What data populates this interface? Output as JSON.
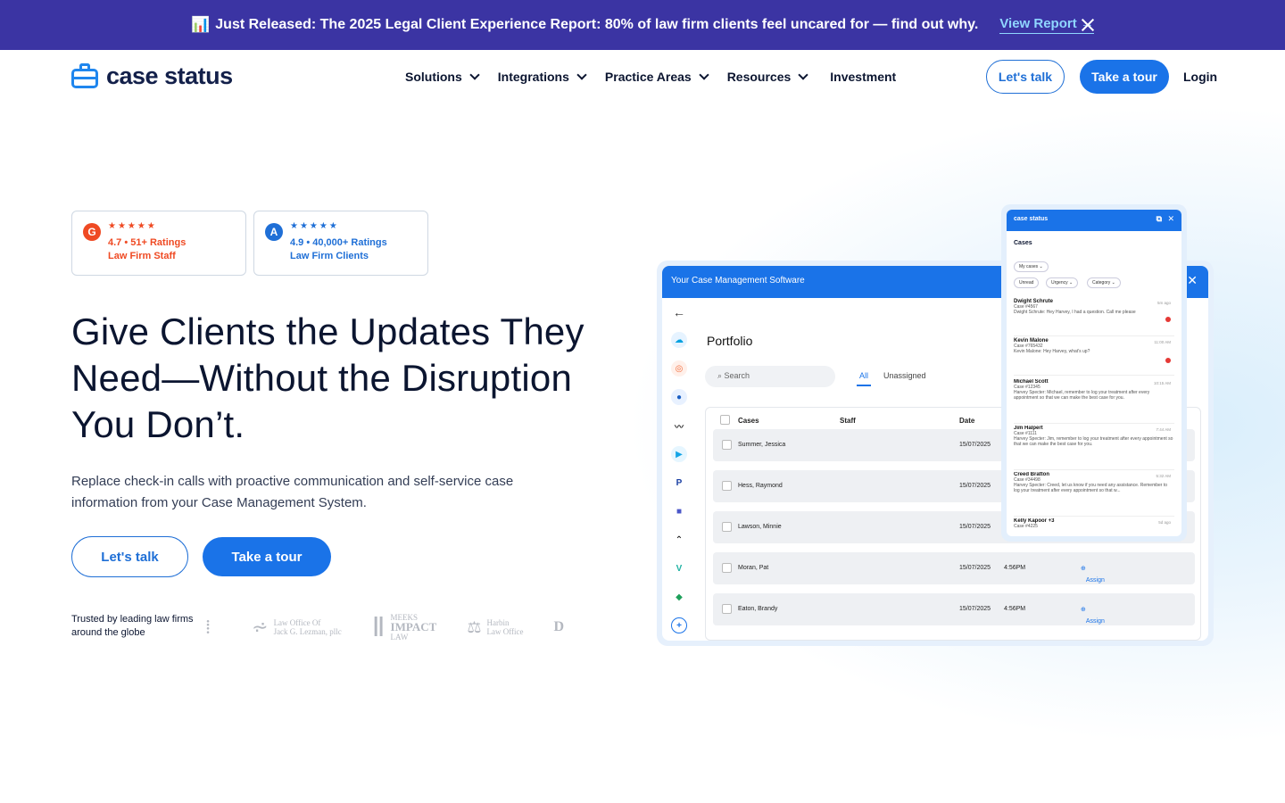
{
  "banner": {
    "emoji": "📊",
    "text": "Just Released: The 2025 Legal Client Experience Report: 80% of law firm clients feel uncared for — find out why.",
    "link": "View Report →"
  },
  "nav": {
    "logo_text": "case status",
    "menu": [
      {
        "label": "Solutions"
      },
      {
        "label": "Integrations"
      },
      {
        "label": "Practice Areas"
      },
      {
        "label": "Resources"
      }
    ],
    "investment": "Investment",
    "lets_talk": "Let's talk",
    "take_tour": "Take a tour",
    "login": "Login"
  },
  "ratings": [
    {
      "icon": "G",
      "stars": "★★★★★",
      "line1": "4.7 • 51+ Ratings",
      "line2": "Law Firm Staff",
      "color": "#ef4a23"
    },
    {
      "icon": "A",
      "stars": "★★★★★",
      "line1": "4.9 • 40,000+ Ratings",
      "line2": "Law Firm Clients",
      "color": "#1f6fd6"
    }
  ],
  "hero": {
    "headline": "Give Clients the Updates They Need—Without the Disruption You Don’t.",
    "sub": "Replace check-in calls with proactive communication and self-service case information from your Case Management System.",
    "cta_talk": "Let's talk",
    "cta_tour": "Take a tour",
    "trusted": "Trusted by leading law firms around the globe"
  },
  "logos": [
    {
      "line1": "Law Office Of",
      "line2": "Jack G. Lezman, pllc"
    },
    {
      "line1": "MEEKS",
      "line2": "IMPACT",
      "line3": "LAW"
    },
    {
      "line1": "Harbin",
      "line2": "Law Office"
    }
  ],
  "app": {
    "bar_title": "Your Case Management Software",
    "page_title": "Portfolio",
    "search_placeholder": "Search",
    "tab_all": "All",
    "tab_unassigned": "Unassigned",
    "col_cases": "Cases",
    "col_staff": "Staff",
    "col_date": "Date",
    "rows": [
      {
        "name": "Summer, Jessica",
        "date": "15/07/2025",
        "time": "4:",
        "assign": ""
      },
      {
        "name": "Hess, Raymond",
        "date": "15/07/2025",
        "time": "4:",
        "assign": ""
      },
      {
        "name": "Lawson, Minnie",
        "date": "15/07/2025",
        "time": "4:",
        "assign": ""
      },
      {
        "name": "Moran, Pat",
        "date": "15/07/2025",
        "time": "4:56PM",
        "assign": "Assign"
      },
      {
        "name": "Eaton, Brandy",
        "date": "15/07/2025",
        "time": "4:56PM",
        "assign": "Assign"
      }
    ]
  },
  "panel": {
    "title": "case status",
    "heading": "Cases",
    "filter_my": "My cases",
    "chips": [
      "Unread",
      "Urgency",
      "Category"
    ],
    "messages": [
      {
        "name": "Dwight Schrute",
        "case": "Case #4567",
        "msg": "Dwight Schrute: Hey Harvey, I had a question. Call me please",
        "time": "5m ago"
      },
      {
        "name": "Kevin Malone",
        "case": "Case #765432",
        "msg": "Kevin Malone: Hey Harvey, what's up?",
        "time": "11:00 AM"
      },
      {
        "name": "Michael Scott",
        "case": "Case #12345",
        "msg": "Harvey Specter: Michael, remember to log your treatment after every appointment so that we can make the best case for you.",
        "time": "10:15 AM"
      },
      {
        "name": "Jim Halpert",
        "case": "Case #1111",
        "msg": "Harvey Specter: Jim, remember to log your treatment after every appointment so that we can make the best case for you.",
        "time": "7:44 AM"
      },
      {
        "name": "Creed Bratton",
        "case": "Case #34498",
        "msg": "Harvey Specter: Creed, let us know if you need any assistance. Remember to log your treatment after every appointment so that w...",
        "time": "5:32 AM"
      },
      {
        "name": "Kelly Kapoor +3",
        "case": "Case #4225",
        "msg": "",
        "time": "5d ago"
      }
    ]
  }
}
